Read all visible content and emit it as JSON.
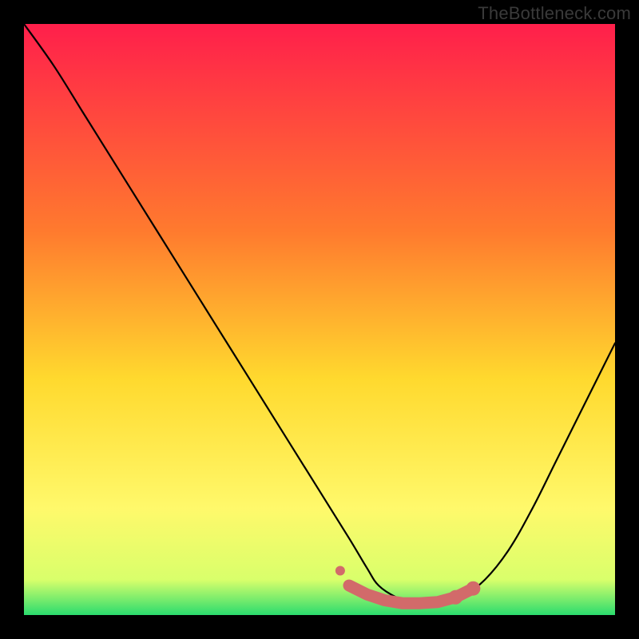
{
  "watermark": "TheBottleneck.com",
  "colors": {
    "frame": "#000000",
    "gradient_top": "#ff1f4b",
    "gradient_mid1": "#ff7a2e",
    "gradient_mid2": "#ffd92e",
    "gradient_mid3": "#fff96b",
    "gradient_bottom": "#2bdc6e",
    "curve": "#000000",
    "marker_fill": "#d26a6a",
    "marker_stroke": "#c85a5a"
  },
  "chart_data": {
    "type": "line",
    "title": "",
    "xlabel": "",
    "ylabel": "",
    "xlim": [
      0,
      100
    ],
    "ylim": [
      0,
      100
    ],
    "series": [
      {
        "name": "bottleneck-curve",
        "x": [
          0,
          5,
          10,
          15,
          20,
          25,
          30,
          35,
          40,
          45,
          50,
          55,
          58,
          60,
          63,
          66,
          70,
          74,
          78,
          82,
          86,
          90,
          94,
          100
        ],
        "y": [
          100,
          93,
          85,
          77,
          69,
          61,
          53,
          45,
          37,
          29,
          21,
          13,
          8,
          5,
          3,
          2,
          2,
          3,
          6,
          11,
          18,
          26,
          34,
          46
        ]
      }
    ],
    "markers": {
      "name": "highlight-band",
      "x": [
        55,
        58,
        61,
        64,
        67,
        70,
        73,
        76
      ],
      "y": [
        5.0,
        3.5,
        2.5,
        2.0,
        2.0,
        2.2,
        3.0,
        4.5
      ]
    },
    "gradient_stops": [
      {
        "offset": 0.0,
        "color": "#ff1f4b"
      },
      {
        "offset": 0.35,
        "color": "#ff7a2e"
      },
      {
        "offset": 0.6,
        "color": "#ffd92e"
      },
      {
        "offset": 0.82,
        "color": "#fff96b"
      },
      {
        "offset": 0.94,
        "color": "#d9ff6b"
      },
      {
        "offset": 1.0,
        "color": "#2bdc6e"
      }
    ]
  }
}
